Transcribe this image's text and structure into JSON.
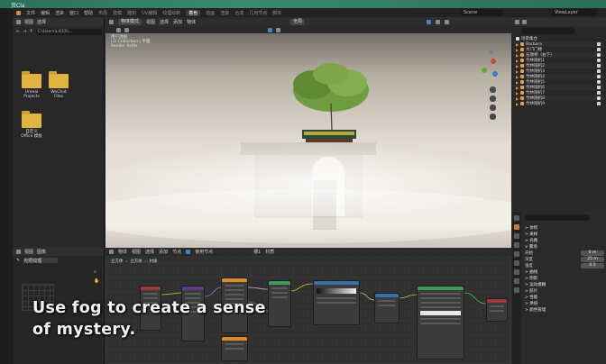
{
  "background": {
    "tag": "页Cla"
  },
  "menubar": {
    "items": [
      "文件",
      "编辑",
      "渲染",
      "窗口",
      "帮助"
    ],
    "workspaces": [
      "布局",
      "建模",
      "雕刻",
      "UV编辑",
      "纹理绘制",
      "着色",
      "动画",
      "渲染",
      "合成",
      "几何节点",
      "脚本"
    ],
    "active_workspace": "着色",
    "scene": "Scene",
    "view_layer": "ViewLayer"
  },
  "file_browser": {
    "header_items": [
      "视图",
      "选择"
    ],
    "path": "C:\\Users\\LIEER\\...",
    "folders": [
      {
        "label": "Unreal Projects"
      },
      {
        "label": "WeChat Files"
      },
      {
        "label": "自定义 Office 模板"
      }
    ]
  },
  "viewport": {
    "mode": "物体模式",
    "header_items": [
      "视图",
      "选择",
      "添加",
      "物体"
    ],
    "transform": "全局",
    "info_lines": [
      "用户透视",
      "(1) Collection | 平面",
      "Render 0s|9s"
    ],
    "colors": {
      "sky": "#d8d2c6",
      "water": "#e9e4dc",
      "tree": "#6f9b41"
    }
  },
  "outliner": {
    "title": "场景集合",
    "items": [
      {
        "label": "Barbara",
        "type": "object"
      },
      {
        "label": "大门门楼",
        "type": "object"
      },
      {
        "label": "石墩桥（右下）",
        "type": "object"
      },
      {
        "label": "竹林随机1",
        "type": "object"
      },
      {
        "label": "竹林随机2",
        "type": "object"
      },
      {
        "label": "竹林随机3",
        "type": "object"
      },
      {
        "label": "竹林随机4",
        "type": "object"
      },
      {
        "label": "竹林随机5",
        "type": "object"
      },
      {
        "label": "竹林随机6",
        "type": "object"
      },
      {
        "label": "竹林随机7",
        "type": "object"
      },
      {
        "label": "竹林随机8",
        "type": "object"
      },
      {
        "label": "竹林随机9",
        "type": "object"
      }
    ]
  },
  "properties": {
    "rows": [
      {
        "label": "> 体积",
        "type": "section"
      },
      {
        "label": "> 采样",
        "type": "section"
      },
      {
        "label": "> 光路",
        "type": "section"
      },
      {
        "label": "∨ 雾场",
        "type": "section"
      },
      {
        "label": "开始",
        "value": "0 m"
      },
      {
        "label": "深度",
        "value": "25 m"
      },
      {
        "label": "强度",
        "value": "0.5"
      },
      {
        "label": "> 曲线",
        "type": "section"
      },
      {
        "label": "> 阴影",
        "type": "section"
      },
      {
        "label": "> 运动模糊",
        "type": "section"
      },
      {
        "label": "> 胶片",
        "type": "section"
      },
      {
        "label": "> 性能",
        "type": "section"
      },
      {
        "label": "> 烘焙",
        "type": "section"
      },
      {
        "label": "> 颜色管理",
        "type": "section"
      }
    ]
  },
  "image_panel": {
    "header_items": [
      "视图",
      "图像"
    ],
    "field": "光照纹理"
  },
  "shader_editor": {
    "header_items": [
      "物体",
      "视图",
      "选择",
      "添加",
      "节点"
    ],
    "use_nodes_label": "使用节点",
    "slot": "槽1",
    "material": "材质",
    "breadcrumb": [
      "立方体",
      "立方体",
      "材质"
    ],
    "nodes": [
      {
        "name": "tex-coord",
        "color": "#9b3a3a"
      },
      {
        "name": "mapping",
        "color": "#5b3a8a"
      },
      {
        "name": "noise-texture",
        "color": "#d98a2a"
      },
      {
        "name": "color-ramp-1",
        "color": "#3b6fa8"
      },
      {
        "name": "color-ramp-2",
        "color": "#3b6fa8"
      },
      {
        "name": "bsdf",
        "color": "#3b9a5a"
      },
      {
        "name": "output",
        "color": "#9b3a3a"
      }
    ]
  },
  "subtitle": {
    "line1": "Use fog to create a sense",
    "line2": "of mystery."
  }
}
